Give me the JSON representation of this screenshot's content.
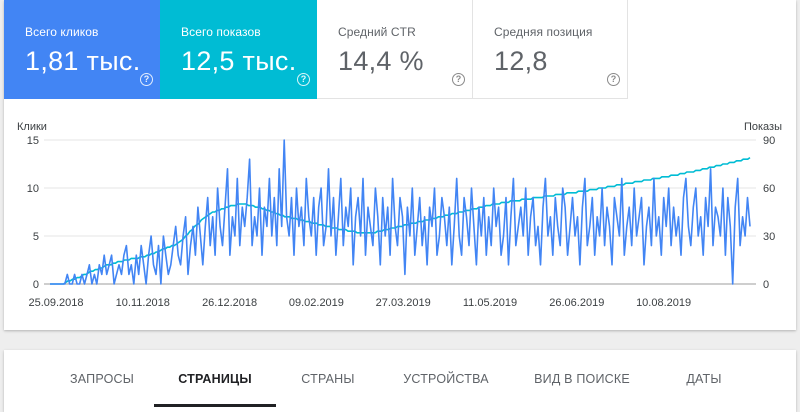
{
  "metrics": [
    {
      "label": "Всего кликов",
      "value": "1,81 тыс.",
      "help": "?"
    },
    {
      "label": "Всего показов",
      "value": "12,5 тыс.",
      "help": "?"
    },
    {
      "label": "Средний CTR",
      "value": "14,4 %",
      "help": "?"
    },
    {
      "label": "Средняя позиция",
      "value": "12,8",
      "help": "?"
    }
  ],
  "colors": {
    "clicks": "#4285f4",
    "impressions": "#00bcd4"
  },
  "tabs": [
    {
      "label": "ЗАПРОСЫ",
      "active": false
    },
    {
      "label": "СТРАНИЦЫ",
      "active": true
    },
    {
      "label": "СТРАНЫ",
      "active": false
    },
    {
      "label": "УСТРОЙСТВА",
      "active": false
    },
    {
      "label": "ВИД В ПОИСКЕ",
      "active": false
    },
    {
      "label": "ДАТЫ",
      "active": false
    }
  ],
  "chart_data": {
    "type": "line",
    "ylabel_left": "Клики",
    "ylabel_right": "Показы",
    "y_left_ticks": [
      0,
      5,
      10,
      15
    ],
    "y_right_ticks": [
      0,
      30,
      60,
      90
    ],
    "ylim_left": [
      0,
      15
    ],
    "ylim_right": [
      0,
      90
    ],
    "x_tick_labels": [
      "25.09.2018",
      "10.11.2018",
      "26.12.2018",
      "09.02.2019",
      "27.03.2019",
      "11.05.2019",
      "26.06.2019",
      "10.08.2019"
    ],
    "grid": "horizontal",
    "series": [
      {
        "name": "Клики",
        "axis": "left",
        "color": "#4285f4",
        "x_range": [
          "2018-09-25",
          "2019-09-26"
        ],
        "values": [
          0,
          0,
          0,
          0,
          0,
          0,
          0,
          1,
          0,
          0,
          1,
          0,
          0,
          1,
          0,
          1,
          2,
          0,
          1,
          0,
          2,
          1,
          3,
          1,
          2,
          3,
          0,
          1,
          2,
          1,
          3,
          4,
          1,
          2,
          0,
          3,
          1,
          4,
          2,
          0,
          3,
          5,
          2,
          1,
          4,
          0,
          5,
          3,
          1,
          2,
          4,
          6,
          3,
          2,
          5,
          7,
          1,
          4,
          6,
          3,
          8,
          5,
          2,
          6,
          9,
          4,
          7,
          3,
          10,
          6,
          4,
          8,
          12,
          3,
          7,
          5,
          11,
          4,
          8,
          6,
          9,
          13,
          4,
          7,
          5,
          10,
          3,
          8,
          6,
          11,
          5,
          9,
          4,
          12,
          6,
          15,
          7,
          5,
          9,
          3,
          10,
          6,
          8,
          4,
          11,
          7,
          5,
          9,
          3,
          8,
          10,
          4,
          6,
          12,
          5,
          9,
          3,
          7,
          11,
          4,
          8,
          6,
          10,
          2,
          7,
          9,
          5,
          11,
          3,
          8,
          6,
          4,
          10,
          7,
          2,
          9,
          5,
          8,
          3,
          11,
          6,
          4,
          9,
          7,
          1,
          8,
          5,
          10,
          3,
          6,
          9,
          4,
          7,
          2,
          8,
          6,
          10,
          3,
          5,
          9,
          7,
          4,
          8,
          2,
          6,
          11,
          5,
          3,
          9,
          7,
          4,
          10,
          6,
          2,
          8,
          5,
          9,
          3,
          7,
          4,
          10,
          6,
          8,
          3,
          5,
          9,
          2,
          7,
          11,
          4,
          6,
          8,
          5,
          10,
          3,
          7,
          9,
          4,
          6,
          2,
          8,
          11,
          5,
          7,
          3,
          9,
          6,
          4,
          10,
          8,
          3,
          6,
          9,
          5,
          7,
          2,
          8,
          11,
          4,
          6,
          9,
          3,
          7,
          5,
          10,
          4,
          8,
          6,
          2,
          9,
          7,
          5,
          11,
          3,
          6,
          8,
          4,
          10,
          5,
          7,
          9,
          2,
          6,
          8,
          4,
          11,
          5,
          7,
          3,
          9,
          6,
          10,
          4,
          8,
          5,
          7,
          3,
          9,
          11,
          6,
          4,
          8,
          10,
          5,
          7,
          3,
          9,
          6,
          12,
          4,
          8,
          7,
          5,
          10,
          3,
          9,
          6,
          0,
          8,
          11,
          4,
          7,
          5,
          9,
          6
        ]
      },
      {
        "name": "Показы",
        "axis": "right",
        "color": "#00bcd4",
        "x_range": [
          "2018-09-25",
          "2019-09-26"
        ],
        "values": [
          0,
          0,
          0,
          0,
          0,
          0,
          0,
          1,
          2,
          2,
          3,
          3,
          4,
          4,
          5,
          6,
          6,
          7,
          8,
          8,
          9,
          9,
          10,
          10,
          11,
          12,
          12,
          12,
          13,
          13,
          14,
          14,
          14,
          15,
          15,
          15,
          16,
          16,
          16,
          16,
          17,
          17,
          17,
          18,
          18,
          19,
          19,
          20,
          20,
          21,
          22,
          22,
          23,
          23,
          24,
          24,
          25,
          26,
          27,
          28,
          30,
          31,
          33,
          34,
          36,
          37,
          38,
          40,
          41,
          42,
          43,
          44,
          45,
          45,
          46,
          46,
          47,
          47,
          48,
          48,
          49,
          49,
          49,
          50,
          50,
          50,
          50,
          50,
          49,
          49,
          49,
          48,
          48,
          48,
          47,
          47,
          46,
          46,
          45,
          45,
          44,
          44,
          43,
          43,
          42,
          42,
          42,
          41,
          41,
          41,
          40,
          40,
          40,
          39,
          39,
          39,
          38,
          38,
          38,
          37,
          37,
          37,
          36,
          36,
          36,
          35,
          35,
          35,
          34,
          34,
          34,
          34,
          33,
          33,
          33,
          33,
          32,
          32,
          32,
          32,
          32,
          32,
          32,
          32,
          32,
          33,
          33,
          33,
          34,
          34,
          34,
          35,
          35,
          35,
          36,
          36,
          36,
          37,
          37,
          37,
          38,
          38,
          38,
          39,
          39,
          39,
          40,
          40,
          40,
          41,
          41,
          41,
          42,
          42,
          42,
          43,
          43,
          43,
          44,
          44,
          44,
          45,
          45,
          45,
          46,
          46,
          46,
          47,
          47,
          47,
          48,
          48,
          48,
          49,
          49,
          49,
          50,
          50,
          50,
          50,
          51,
          51,
          51,
          51,
          52,
          52,
          52,
          52,
          52,
          53,
          53,
          53,
          53,
          53,
          54,
          54,
          54,
          54,
          54,
          55,
          55,
          55,
          55,
          55,
          56,
          56,
          56,
          56,
          56,
          57,
          57,
          57,
          57,
          57,
          58,
          58,
          58,
          58,
          58,
          59,
          59,
          59,
          59,
          60,
          60,
          60,
          60,
          61,
          61,
          61,
          61,
          62,
          62,
          62,
          62,
          63,
          63,
          63,
          63,
          64,
          64,
          64,
          64,
          65,
          65,
          65,
          65,
          66,
          66,
          66,
          66,
          67,
          67,
          67,
          67,
          68,
          68,
          68,
          68,
          69,
          69,
          69,
          70,
          70,
          70,
          70,
          71,
          71,
          71,
          72,
          72,
          72,
          73,
          73,
          73,
          74,
          74,
          74,
          75,
          75,
          75,
          76,
          76,
          76,
          77,
          77,
          77,
          78,
          78,
          78,
          79
        ]
      }
    ]
  }
}
